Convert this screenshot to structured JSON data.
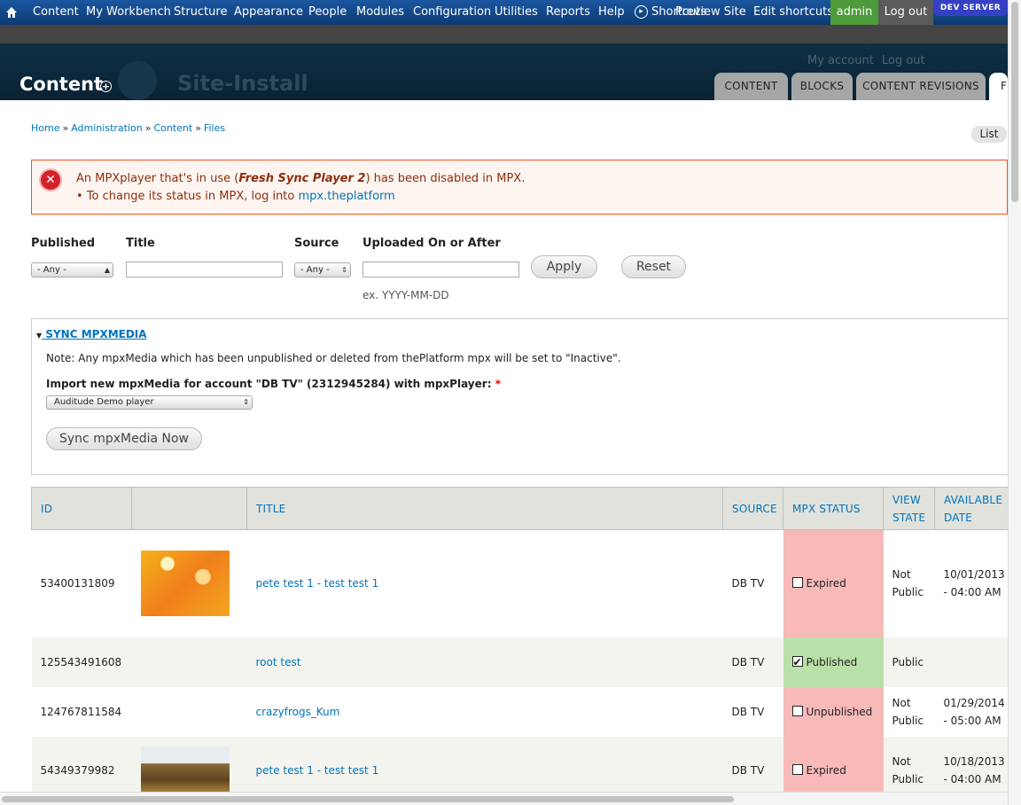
{
  "toolbar": {
    "home_icon": "home-icon",
    "menu": [
      "Content",
      "My Workbench",
      "Structure",
      "Appearance",
      "People",
      "Modules",
      "Configuration",
      "Utilities",
      "Reports",
      "Help"
    ],
    "shortcuts": "Shortcuts",
    "preview_site": "Preview Site",
    "edit_shortcuts": "Edit shortcuts",
    "user": "admin",
    "logout": "Log out",
    "dev_server": "DEV SERVER"
  },
  "header": {
    "my_account": "My account",
    "log_out": "Log out",
    "title": "Content",
    "site_name": "Site-Install",
    "tabs": [
      "CONTENT",
      "BLOCKS",
      "CONTENT REVISIONS",
      "FI"
    ]
  },
  "breadcrumb": [
    "Home",
    "Administration",
    "Content",
    "Files"
  ],
  "list_tab": "List",
  "error": {
    "line1_pre": "An MPXplayer that's in use (",
    "line1_em": "Fresh Sync Player 2",
    "line1_post": ") has been disabled in MPX.",
    "line2_pre": "To change its status in MPX, log into ",
    "line2_link": "mpx.theplatform"
  },
  "filters": {
    "published_label": "Published",
    "published_value": "- Any -",
    "title_label": "Title",
    "title_value": "",
    "source_label": "Source",
    "source_value": "- Any -",
    "uploaded_label": "Uploaded On or After",
    "uploaded_value": "",
    "date_hint": "ex. YYYY-MM-DD",
    "apply": "Apply",
    "reset": "Reset"
  },
  "sync": {
    "legend": "SYNC MPXMEDIA",
    "note": "Note: Any mpxMedia which has been unpublished or deleted from thePlatform mpx will be set to \"Inactive\".",
    "import_label": "Import new mpxMedia for account \"DB TV\" (2312945284) with mpxPlayer:",
    "required_mark": "*",
    "player_value": "Auditude Demo player",
    "sync_button": "Sync mpxMedia Now"
  },
  "table": {
    "headers": {
      "id": "ID",
      "thumb": "",
      "title": "TITLE",
      "source": "SOURCE",
      "status": "MPX STATUS",
      "view_state_1": "VIEW",
      "view_state_2": "STATE",
      "available_1": "AVAILABLE",
      "available_2": "DATE"
    },
    "rows": [
      {
        "id": "53400131809",
        "title": "pete test 1 - test test 1",
        "source": "DB TV",
        "status": "Expired",
        "view_1": "Not",
        "view_2": "Public",
        "date_1": "10/01/2013",
        "date_2": "- 04:00 AM"
      },
      {
        "id": "125543491608",
        "title": "root test",
        "source": "DB TV",
        "status": "Published",
        "view_1": "Public",
        "view_2": "",
        "date_1": "",
        "date_2": ""
      },
      {
        "id": "124767811584",
        "title": "crazyfrogs_Kum",
        "source": "DB TV",
        "status": "Unpublished",
        "view_1": "Not",
        "view_2": "Public",
        "date_1": "01/29/2014",
        "date_2": "- 05:00 AM"
      },
      {
        "id": "54349379982",
        "title": "pete test 1 - test test 1",
        "source": "DB TV",
        "status": "Expired",
        "view_1": "Not",
        "view_2": "Public",
        "date_1": "10/18/2013",
        "date_2": "- 04:00 AM"
      }
    ]
  },
  "colors": {
    "toolbar": "#0c3a72",
    "header": "#0a2233",
    "link": "#0074bd",
    "error_border": "#ed541d",
    "status_red": "#f8b9b9",
    "status_green": "#b9e0a8"
  }
}
